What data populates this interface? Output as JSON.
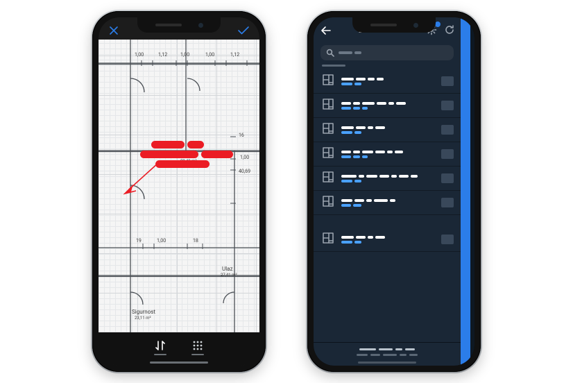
{
  "phone1": {
    "header": {
      "close_icon": "x",
      "confirm_icon": "check"
    },
    "annotation": {
      "color": "#eb1c24"
    },
    "labels": {
      "room_a": "Sigurnost",
      "room_a_area": "23,11 m²",
      "room_b": "Ulaz",
      "room_b_area": "27,41 m²",
      "dim_top_a": "1,00",
      "dim_top_b": "1,12",
      "dim_top_c": "1,00",
      "dim_top_d": "1,00",
      "dim_top_e": "1,12",
      "dim_r_a": "16",
      "dim_r_b": "1,00",
      "dim_r_c": "40,69",
      "dim_mid_room": "89,43 m²",
      "dim_bot_a": "19",
      "dim_bot_b": "1,00",
      "dim_bot_c": "18"
    },
    "toolbar": {
      "tool_a": "sort",
      "tool_b": "grid"
    }
  },
  "phone2": {
    "header": {
      "back_icon": "back",
      "settings_icon": "gear",
      "refresh_icon": "refresh",
      "settings_badge": true
    },
    "search": {
      "icon": "search"
    },
    "rows_count": 7
  }
}
